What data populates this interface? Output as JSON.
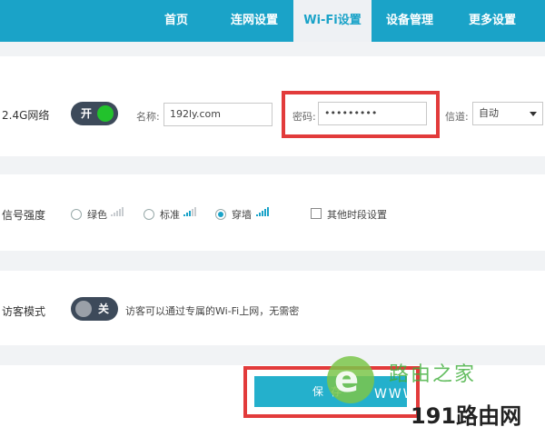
{
  "nav": [
    {
      "label": "首页"
    },
    {
      "label": "连网设置"
    },
    {
      "label": "Wi-Fi设置",
      "active": true
    },
    {
      "label": "设备管理"
    },
    {
      "label": "更多设置"
    }
  ],
  "wifi24": {
    "label": "2.4G网络",
    "toggle": {
      "label": "开",
      "state": "on"
    },
    "name_label": "名称:",
    "name_value": "192ly.com",
    "password_label": "密码:",
    "password_value": "•••••••••",
    "channel_label": "信道:",
    "channel_value": "自动"
  },
  "signal": {
    "label": "信号强度",
    "options": [
      {
        "label": "绿色",
        "checked": false
      },
      {
        "label": "标准",
        "checked": false
      },
      {
        "label": "穿墙",
        "checked": true
      }
    ],
    "schedule_label": "其他时段设置",
    "schedule_checked": false
  },
  "guest": {
    "label": "访客模式",
    "toggle": {
      "label": "关",
      "state": "off"
    },
    "hint": "访客可以通过专属的Wi-Fi上网，无需密"
  },
  "save_label": "保存",
  "watermark": {
    "brand_top": "路由之家",
    "www": "WWW",
    "brand_bottom": "191路由网"
  },
  "colors": {
    "accent": "#1aa3c8",
    "toggle_on": "#22c22c",
    "highlight": "#e23b3b"
  }
}
